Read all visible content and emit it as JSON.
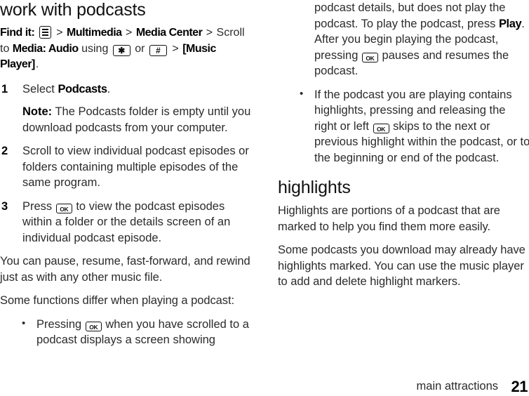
{
  "document": {
    "left_column": {
      "heading": "work with podcasts",
      "find_it": {
        "label": "Find it:",
        "menu_key_icon": "menu-key-icon",
        "path_1": "Multimedia",
        "path_2": "Media Center",
        "scroll_text": "Scroll to",
        "scroll_target": "Media: Audio",
        "using_text": "using",
        "star_key": "✱",
        "or_text": "or",
        "pound_key": "#",
        "final_target": "[Music Player]",
        "period": ".",
        "separator": ">"
      },
      "steps": [
        {
          "number": "1",
          "text_before": "Select ",
          "keyword": "Podcasts",
          "text_after": ".",
          "note_label": "Note:",
          "note_text": " The Podcasts folder is empty until you download podcasts from your computer."
        },
        {
          "number": "2",
          "text_before": "Scroll to view individual podcast episodes or folders containing multiple episodes of the same program.",
          "keyword": "",
          "text_after": ""
        },
        {
          "number": "3",
          "text_before": "Press ",
          "key_icon": "ok-key-icon",
          "text_after": " to view the podcast episodes within a folder or the details screen of an individual podcast episode."
        }
      ],
      "paragraph_1": "You can pause, resume, fast-forward, and rewind just as with any other music file.",
      "paragraph_2": "Some functions differ when playing a podcast:",
      "bullet_1": {
        "text_before": "Pressing ",
        "key_icon": "ok-key-icon",
        "text_after": " when you have scrolled to a podcast displays a screen showing"
      }
    },
    "right_column": {
      "bullet_1_continued": {
        "text_1": "podcast details, but does not play the podcast. To play the podcast, press ",
        "keyword": "Play",
        "text_2": ". After you begin playing the podcast, pressing ",
        "key_icon": "ok-key-icon",
        "text_3": " pauses and resumes the podcast."
      },
      "bullet_2": {
        "text_before": "If the podcast you are playing contains highlights, pressing and releasing the right or left ",
        "key_icon": "ok-key-icon",
        "text_after": " skips to the next or previous highlight within the podcast, or to the beginning or end of the podcast."
      },
      "heading": "highlights",
      "paragraph_1": "Highlights are portions of a podcast that are marked to help you find them more easily.",
      "paragraph_2": "Some podcasts you download may already have highlights marked. You can use the music player to add and delete highlight markers."
    },
    "footer": {
      "label": "main attractions",
      "page_number": "21"
    }
  }
}
